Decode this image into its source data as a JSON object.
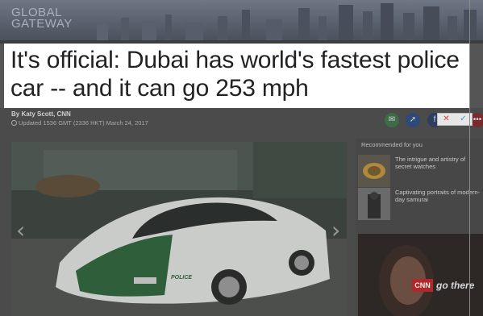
{
  "banner": {
    "brand_line1": "GLOBAL",
    "brand_line2": "GATEWAY"
  },
  "headline": {
    "text": "It's official: Dubai has world's fastest police car -- and it can go 253 mph"
  },
  "byline": {
    "author": "By Katy Scott, CNN",
    "updated": "Updated 1536 GMT (2336 HKT) March 24, 2017"
  },
  "share_icons": [
    "email-icon",
    "messenger-icon",
    "facebook-icon",
    "more-icon"
  ],
  "toolbar": {
    "reject": "✕",
    "accept": "✓"
  },
  "hero": {
    "car_plate_text": "POLICE",
    "prev_arrow": "‹",
    "next_arrow": "›"
  },
  "sidebar": {
    "heading": "Recommended for you",
    "items": [
      {
        "title": "The intrigue and artistry of secret watches"
      },
      {
        "title": "Captivating portraits of modern-day samurai"
      }
    ],
    "video": {
      "logo": "CNN",
      "tagline": "go there"
    }
  },
  "colors": {
    "highlight_bg": "#ffffff",
    "dim_overlay": "#4b4b4b",
    "cnn_red": "#b0282a"
  }
}
